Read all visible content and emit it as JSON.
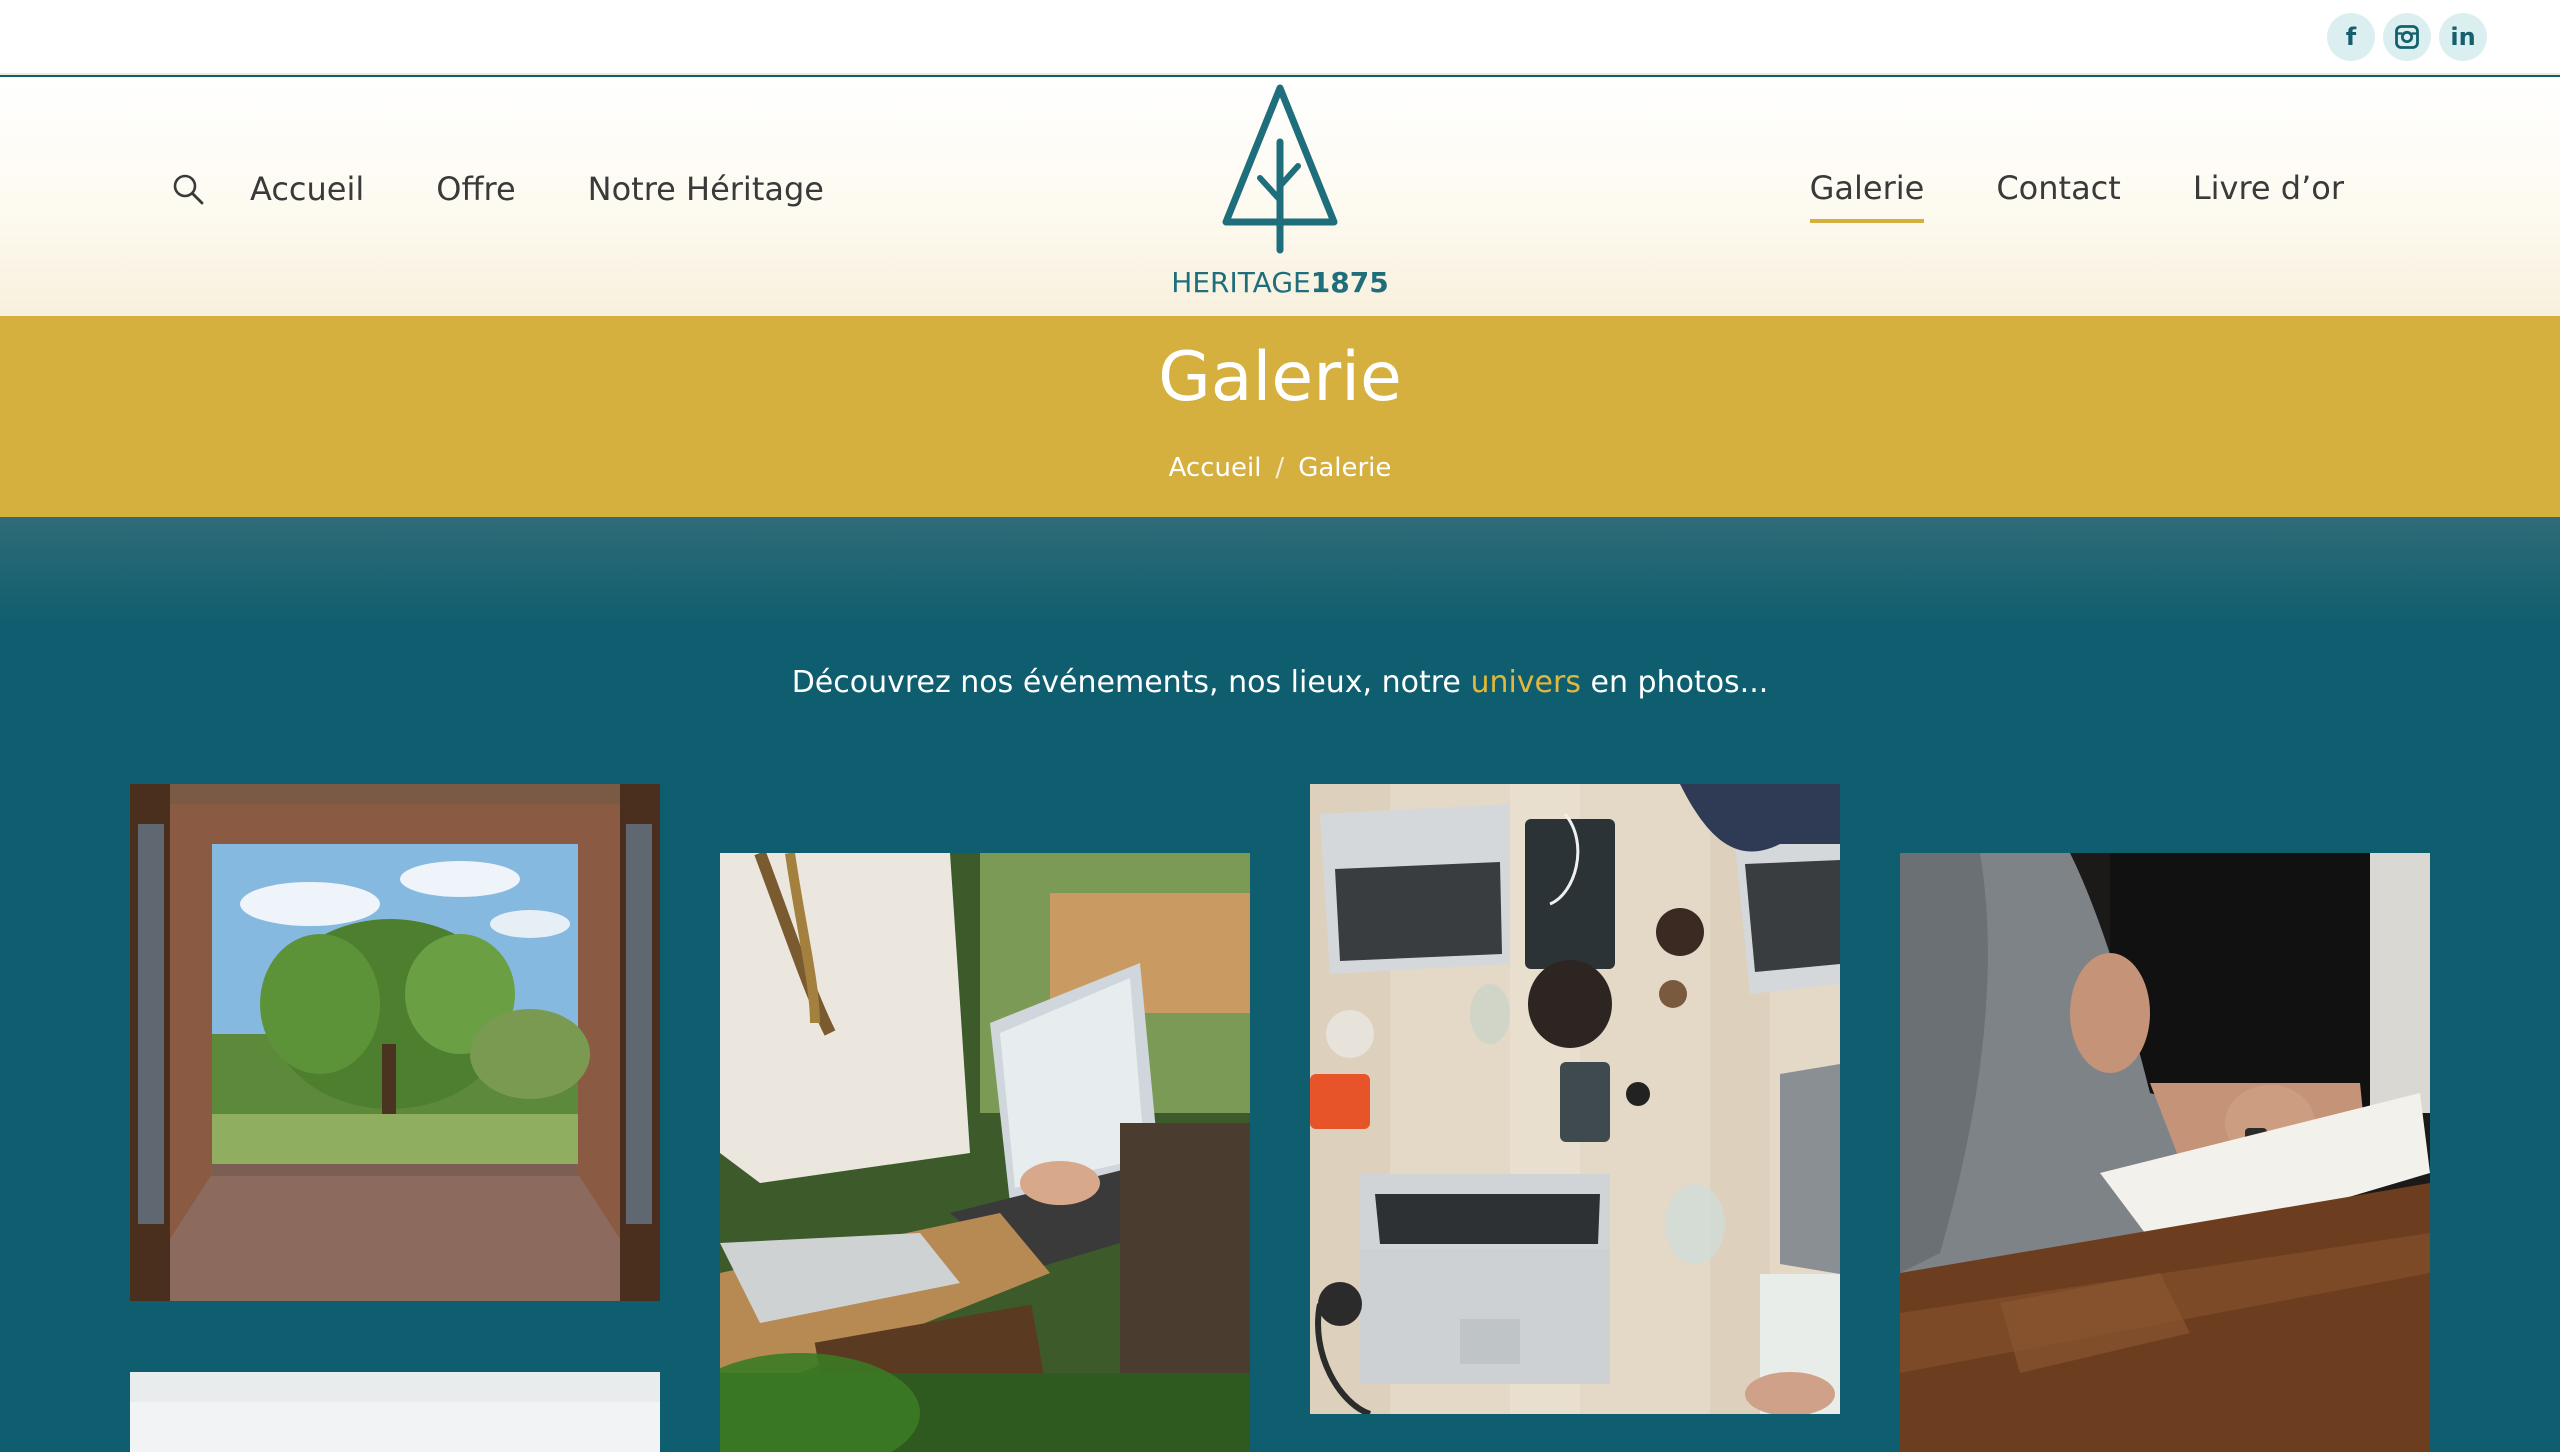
{
  "social": {
    "facebook_label": "f",
    "linkedin_label": "in"
  },
  "nav": {
    "left": [
      {
        "label": "Accueil"
      },
      {
        "label": "Offre"
      },
      {
        "label": "Notre Héritage"
      }
    ],
    "right": [
      {
        "label": "Galerie",
        "active": true
      },
      {
        "label": "Contact"
      },
      {
        "label": "Livre d’or"
      }
    ]
  },
  "logo": {
    "word": "HERITAGE",
    "number": "1875"
  },
  "banner": {
    "title": "Galerie",
    "breadcrumb_home": "Accueil",
    "breadcrumb_separator": "/",
    "breadcrumb_current": "Galerie"
  },
  "intro": {
    "before": "Découvrez nos événements, nos lieux, notre ",
    "accent": "univers",
    "after": " en photos..."
  },
  "colors": {
    "brand_teal": "#0e5e6f",
    "gold": "#d5b03f",
    "logo_teal": "#1f6e7c"
  },
  "gallery": [
    {
      "subject": "open door onto garden with tree"
    },
    {
      "subject": "people working at table with laptop"
    },
    {
      "subject": "overhead view of desk with laptops"
    },
    {
      "subject": "two people talking at wooden table"
    },
    {
      "subject": "light photo partially visible"
    }
  ]
}
